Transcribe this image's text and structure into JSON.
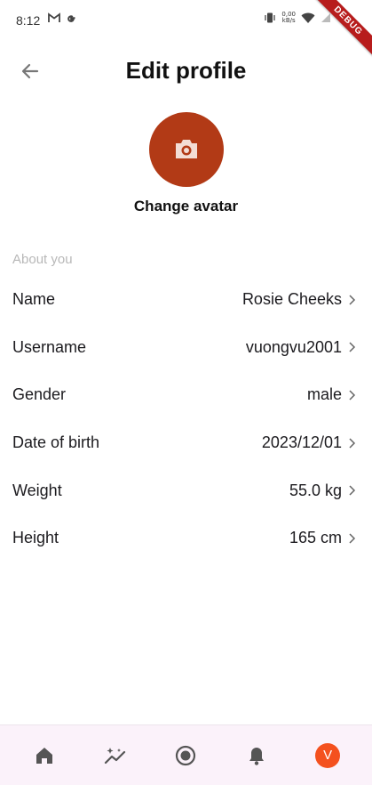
{
  "status_bar": {
    "time": "8:12",
    "network_speed_top": "0,00",
    "network_speed_bottom": "kB/s"
  },
  "debug_banner": "DEBUG",
  "header": {
    "title": "Edit profile"
  },
  "avatar": {
    "change_label": "Change avatar",
    "background_color": "#b23a16"
  },
  "section": {
    "title": "About you"
  },
  "profile_fields": [
    {
      "label": "Name",
      "value": "Rosie Cheeks"
    },
    {
      "label": "Username",
      "value": "vuongvu2001"
    },
    {
      "label": "Gender",
      "value": "male"
    },
    {
      "label": "Date of birth",
      "value": "2023/12/01"
    },
    {
      "label": "Weight",
      "value": "55.0 kg"
    },
    {
      "label": "Height",
      "value": "165 cm"
    }
  ],
  "bottom_nav": {
    "items": [
      "home-icon",
      "sparkle-chart-icon",
      "record-icon",
      "bell-icon",
      "profile-avatar"
    ],
    "avatar_letter": "V",
    "avatar_color": "#f4511e"
  }
}
